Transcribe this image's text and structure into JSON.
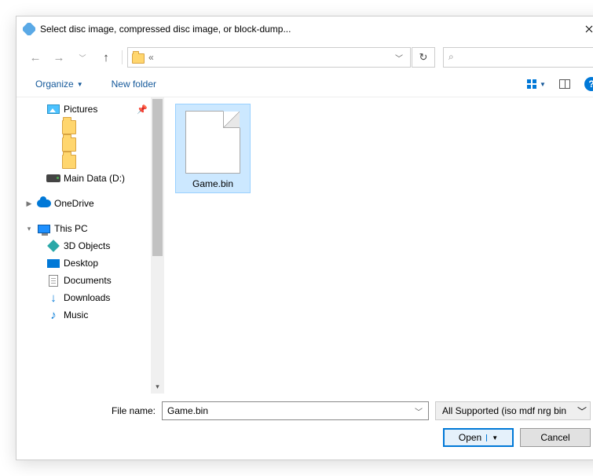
{
  "window": {
    "title": "Select disc image, compressed disc image, or block-dump..."
  },
  "navbar": {
    "address": "«"
  },
  "toolbar": {
    "organize": "Organize",
    "new_folder": "New folder"
  },
  "sidebar": {
    "items": [
      {
        "label": "Pictures",
        "icon": "pictures",
        "indent": 1,
        "pin": true
      },
      {
        "label": "",
        "icon": "folder-big",
        "indent": 2
      },
      {
        "label": "",
        "icon": "folder-big",
        "indent": 2
      },
      {
        "label": "",
        "icon": "folder-big",
        "indent": 2
      },
      {
        "label": "Main Data (D:)",
        "icon": "drive",
        "indent": 1
      },
      {
        "gap": true
      },
      {
        "label": "OneDrive",
        "icon": "cloud",
        "indent": 0,
        "chevron": "right"
      },
      {
        "gap": true
      },
      {
        "label": "This PC",
        "icon": "pc",
        "indent": 0,
        "chevron": "down"
      },
      {
        "label": "3D Objects",
        "icon": "3d",
        "indent": 1
      },
      {
        "label": "Desktop",
        "icon": "desktop",
        "indent": 1
      },
      {
        "label": "Documents",
        "icon": "doc",
        "indent": 1
      },
      {
        "label": "Downloads",
        "icon": "download",
        "indent": 1
      },
      {
        "label": "Music",
        "icon": "music",
        "indent": 1
      }
    ]
  },
  "files": {
    "items": [
      {
        "label": "Game.bin",
        "selected": true
      }
    ]
  },
  "footer": {
    "filename_label": "File name:",
    "filename_value": "Game.bin",
    "filter_value": "All Supported (iso mdf nrg bin",
    "open": "Open",
    "cancel": "Cancel"
  }
}
